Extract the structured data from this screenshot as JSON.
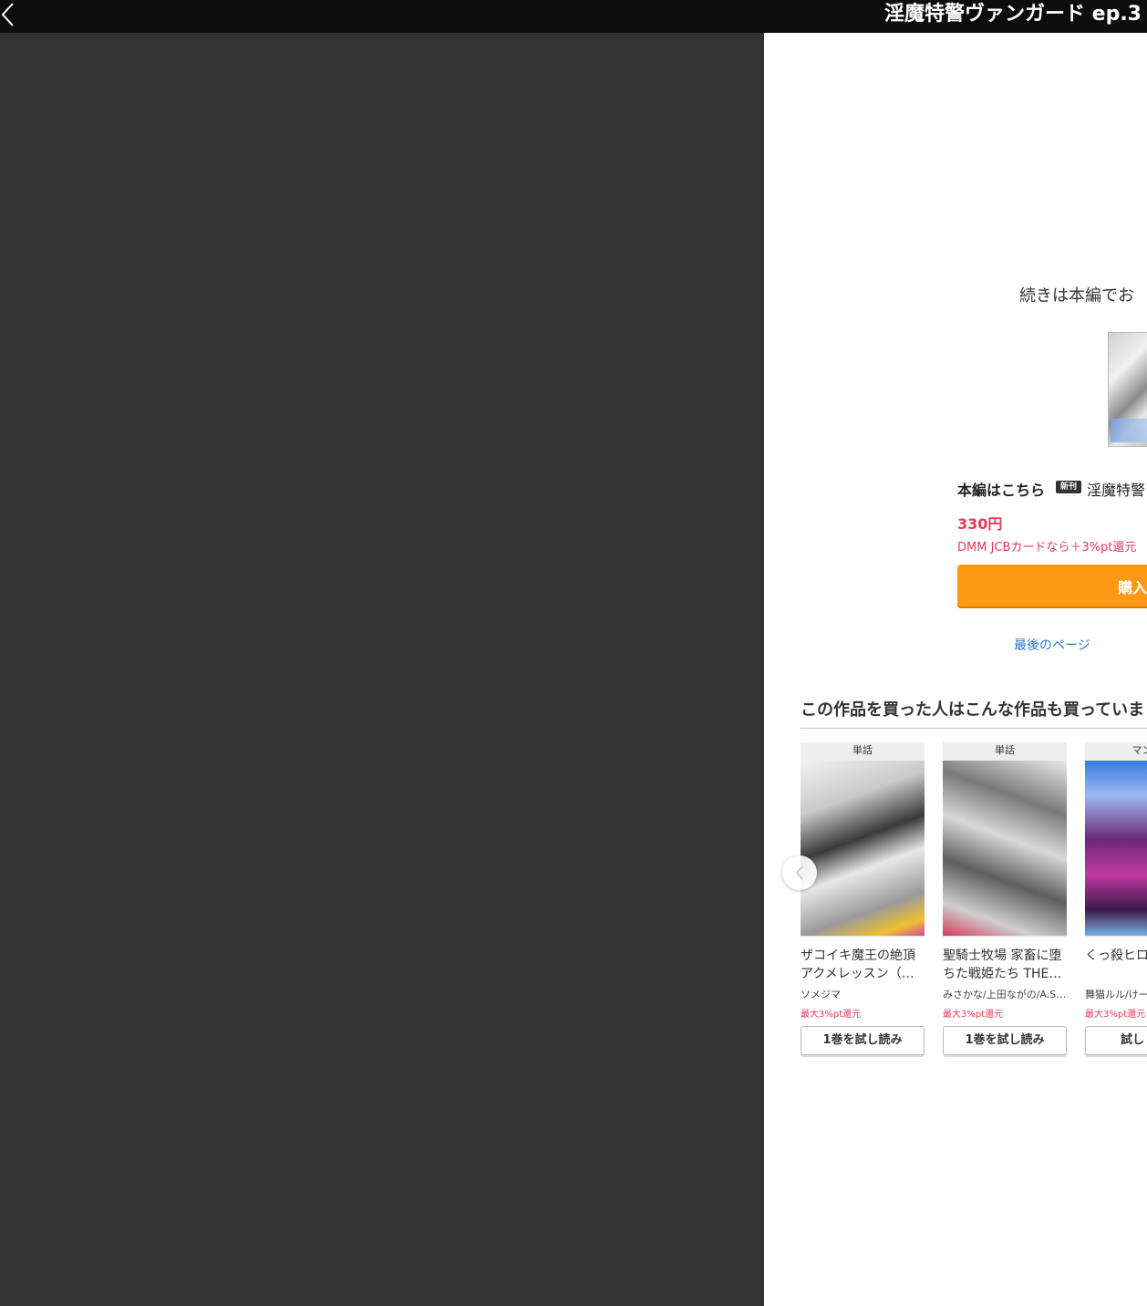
{
  "header": {
    "title": "淫魔特警ヴァンガード ep.3"
  },
  "end_page": {
    "continue_text": "続きは本編でお",
    "main_label": "本編はこちら",
    "new_badge": "新刊",
    "main_title": "淫魔特警",
    "price": "330円",
    "card_note": "DMM JCBカードなら＋3%pt還元",
    "buy_label": "購入",
    "last_page_link": "最後のページ"
  },
  "recommendations": {
    "heading": "この作品を買った人はこんな作品も買っていま",
    "items": [
      {
        "kind": "単話",
        "title": "ザコイキ魔王の絶頂アクメレッスン（…",
        "author": "ソメジマ",
        "reward": "最大3%pt還元",
        "button": "1巻を試し読み"
      },
      {
        "kind": "単話",
        "title": "聖騎士牧場 家畜に堕ちた戦姫たち THE…",
        "author": "みさかな/上田ながの/A.S…",
        "reward": "最大3%pt還元",
        "button": "1巻を試し読み"
      },
      {
        "kind": "マンガ",
        "title": "くっ殺ヒロ",
        "author": "舞猫ルル/けー",
        "reward": "最大3%pt還元",
        "button": "試し"
      }
    ]
  },
  "icons": {
    "back": "chevron-left-icon",
    "carousel_prev": "chevron-left-icon"
  },
  "colors": {
    "accent_orange": "#ff9913",
    "price_red": "#e73b5b",
    "link_blue": "#2a7ac8",
    "viewer_background": "#333333",
    "header_background": "#0d0d0d"
  }
}
